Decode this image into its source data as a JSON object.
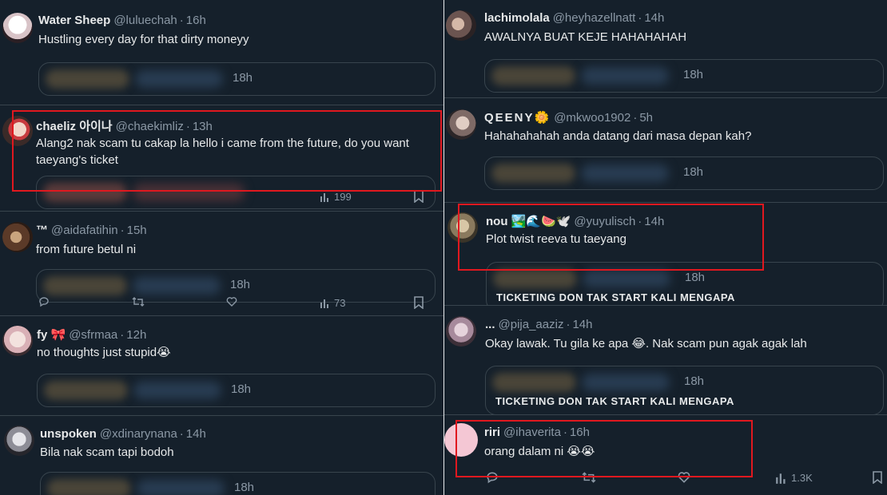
{
  "left_column": {
    "tweets": [
      {
        "name": "Water Sheep",
        "handle": "@luluechah",
        "time": "16h",
        "text": "Hustling every day for that dirty moneyy",
        "quote_time": "18h"
      },
      {
        "name": "chaeliz 아이나",
        "handle": "@chaekimliz",
        "time": "13h",
        "text": "Alang2 nak scam tu cakap la hello i came from the future, do you want taeyang's ticket",
        "views": "199"
      },
      {
        "name": "™",
        "handle": "@aidafatihin",
        "time": "15h",
        "text": "from future betul ni",
        "quote_time": "18h",
        "views": "73"
      },
      {
        "name": "fy 🎀",
        "handle": "@sfrmaa",
        "time": "12h",
        "text": "no thoughts just stupid😭",
        "quote_time": "18h"
      },
      {
        "name": "unspoken",
        "handle": "@xdinarynana",
        "time": "14h",
        "text": "Bila nak scam tapi bodoh",
        "quote_time": "18h"
      }
    ]
  },
  "right_column": {
    "tweets": [
      {
        "name": "lachimolala",
        "handle": "@heyhazellnatt",
        "time": "14h",
        "text": "AWALNYA BUAT KEJE HAHAHAHAH",
        "quote_time": "18h"
      },
      {
        "name": "QEENY🌼",
        "handle": "@mkwoo1902",
        "time": "5h",
        "text": "Hahahahahah anda datang dari masa depan kah?",
        "quote_time": "18h"
      },
      {
        "name": "nou 🏞️🌊🍉🕊️",
        "handle": "@yuyulisch",
        "time": "14h",
        "text": "Plot twist reeva tu taeyang",
        "quote_time": "18h",
        "quote_snippet": "TICKETING DON TAK START KALI MENGAPA"
      },
      {
        "name": "...",
        "handle": "@pija_aaziz",
        "time": "14h",
        "text": "Okay lawak. Tu gila ke apa 😂. Nak scam pun agak agak lah",
        "quote_time": "18h",
        "quote_snippet": "TICKETING DON TAK START KALI MENGAPA"
      },
      {
        "name": "riri",
        "handle": "@ihaverita",
        "time": "16h",
        "text": "orang dalam ni 😭😭",
        "views": "1.3K"
      }
    ]
  },
  "ui": {
    "dot": "·"
  },
  "colors": {
    "background": "#15202b",
    "text_primary": "#e7e9ea",
    "text_secondary": "#8b98a5",
    "border": "#38444d",
    "highlight_box": "#e0181f",
    "accent": "#1d9bf0"
  },
  "icons": [
    "reply-icon",
    "retweet-icon",
    "like-icon",
    "views-icon",
    "bookmark-icon"
  ]
}
